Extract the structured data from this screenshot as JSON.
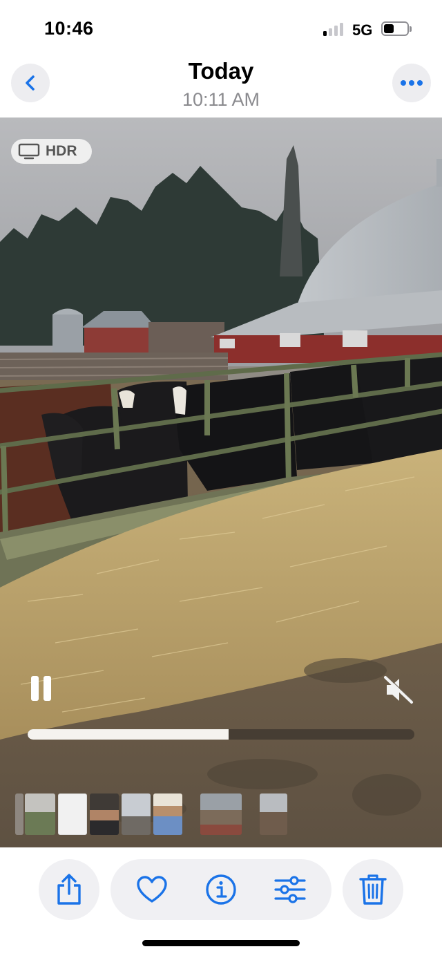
{
  "status_bar": {
    "time": "10:46",
    "network": "5G",
    "signal_bars_active": 1,
    "signal_bars_total": 4,
    "battery_level": 0.45
  },
  "header": {
    "title": "Today",
    "subtitle": "10:11 AM",
    "back_icon": "chevron-left-icon",
    "more_icon": "ellipsis-icon"
  },
  "media": {
    "badge_label": "HDR",
    "badge_icon": "display-icon",
    "play_state_icon": "pause-icon",
    "sound_icon": "speaker-muted-icon",
    "progress": 0.52
  },
  "toolbar": {
    "share_icon": "share-icon",
    "favorite_icon": "heart-icon",
    "info_icon": "info-icon",
    "adjust_icon": "sliders-icon",
    "delete_icon": "trash-icon"
  },
  "colors": {
    "accent": "#1a73e8",
    "muted_text": "#8a8a8e",
    "button_bg": "#f0f0f3"
  }
}
